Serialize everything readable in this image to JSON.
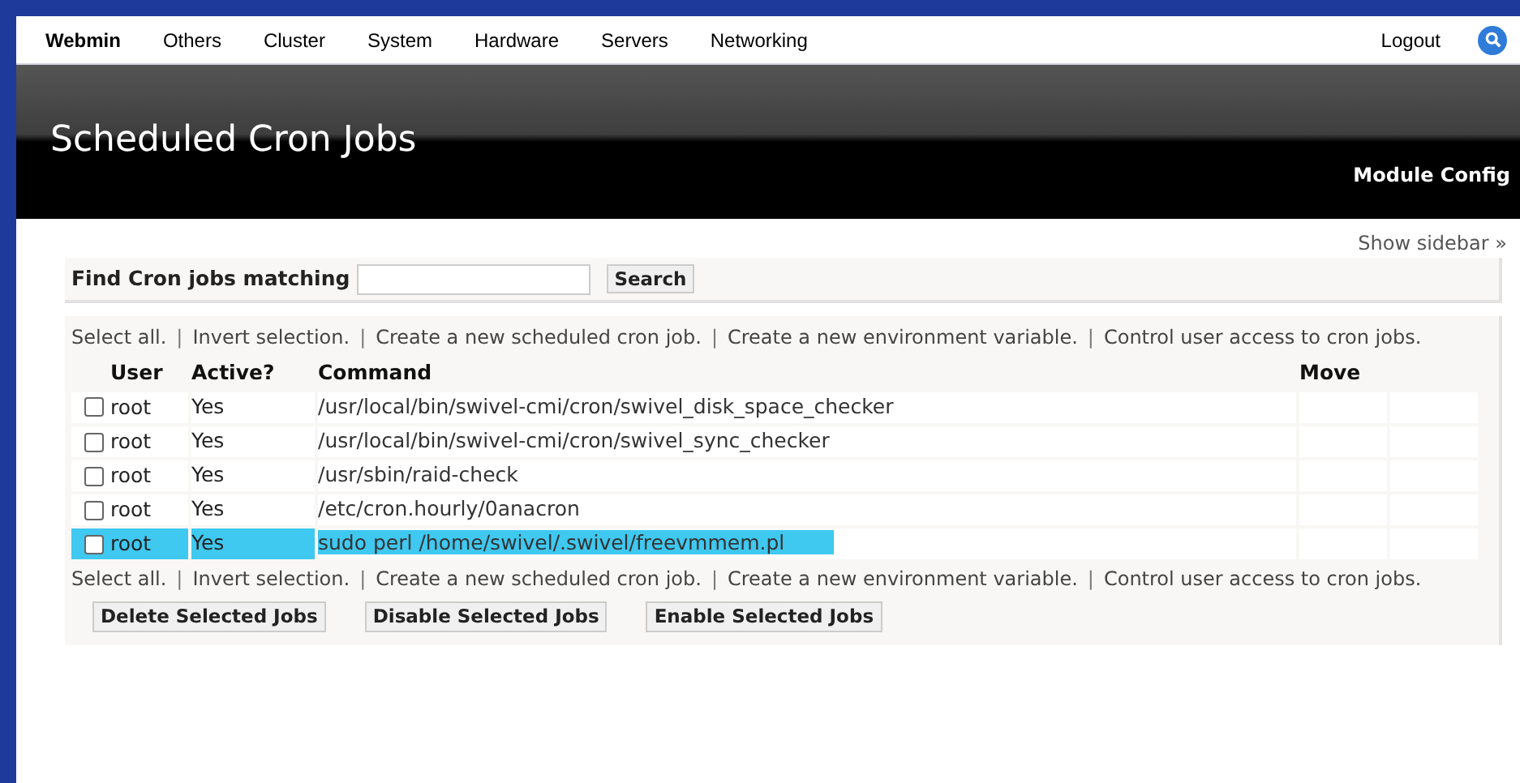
{
  "nav": {
    "items": [
      {
        "label": "Webmin",
        "selected": true
      },
      {
        "label": "Others",
        "selected": false
      },
      {
        "label": "Cluster",
        "selected": false
      },
      {
        "label": "System",
        "selected": false
      },
      {
        "label": "Hardware",
        "selected": false
      },
      {
        "label": "Servers",
        "selected": false
      },
      {
        "label": "Networking",
        "selected": false
      }
    ],
    "logout": "Logout"
  },
  "header": {
    "title": "Scheduled Cron Jobs",
    "module_config": "Module Config"
  },
  "show_sidebar": "Show sidebar »",
  "search": {
    "label": "Find Cron jobs matching",
    "button": "Search"
  },
  "links": [
    {
      "kind": "link",
      "text": "Select all."
    },
    {
      "kind": "separator",
      "text": "|"
    },
    {
      "kind": "link",
      "text": "Invert selection."
    },
    {
      "kind": "separator",
      "text": "|"
    },
    {
      "kind": "link",
      "text": "Create a new scheduled cron job."
    },
    {
      "kind": "separator",
      "text": "|"
    },
    {
      "kind": "link",
      "text": "Create a new environment variable."
    },
    {
      "kind": "separator",
      "text": "|"
    },
    {
      "kind": "link",
      "text": "Control user access to cron jobs."
    }
  ],
  "table": {
    "columns": [
      "User",
      "Active?",
      "Command",
      "Move"
    ],
    "rows": [
      {
        "user": "root",
        "active": "Yes",
        "command": "/usr/local/bin/swivel-cmi/cron/swivel_disk_space_checker",
        "checked": false,
        "highlighted": false
      },
      {
        "user": "root",
        "active": "Yes",
        "command": "/usr/local/bin/swivel-cmi/cron/swivel_sync_checker",
        "checked": false,
        "highlighted": false
      },
      {
        "user": "root",
        "active": "Yes",
        "command": "/usr/sbin/raid-check",
        "checked": false,
        "highlighted": false
      },
      {
        "user": "root",
        "active": "Yes",
        "command": "/etc/cron.hourly/0anacron",
        "checked": false,
        "highlighted": false
      },
      {
        "user": "root",
        "active": "Yes",
        "command": "sudo perl /home/swivel/.swivel/freevmmem.pl",
        "checked": false,
        "highlighted": true
      }
    ]
  },
  "links_bottom": [
    {
      "kind": "link",
      "text": "Select all."
    },
    {
      "kind": "separator",
      "text": "|"
    },
    {
      "kind": "link",
      "text": "Invert selection."
    },
    {
      "kind": "separator",
      "text": "|"
    },
    {
      "kind": "link",
      "text": "Create a new scheduled cron job."
    },
    {
      "kind": "separator",
      "text": "|"
    },
    {
      "kind": "link",
      "text": "Create a new environment variable."
    },
    {
      "kind": "separator",
      "text": "|"
    },
    {
      "kind": "link",
      "text": "Control user access to cron jobs."
    }
  ],
  "buttons": [
    "Delete Selected Jobs",
    "Disable Selected Jobs",
    "Enable Selected Jobs"
  ]
}
